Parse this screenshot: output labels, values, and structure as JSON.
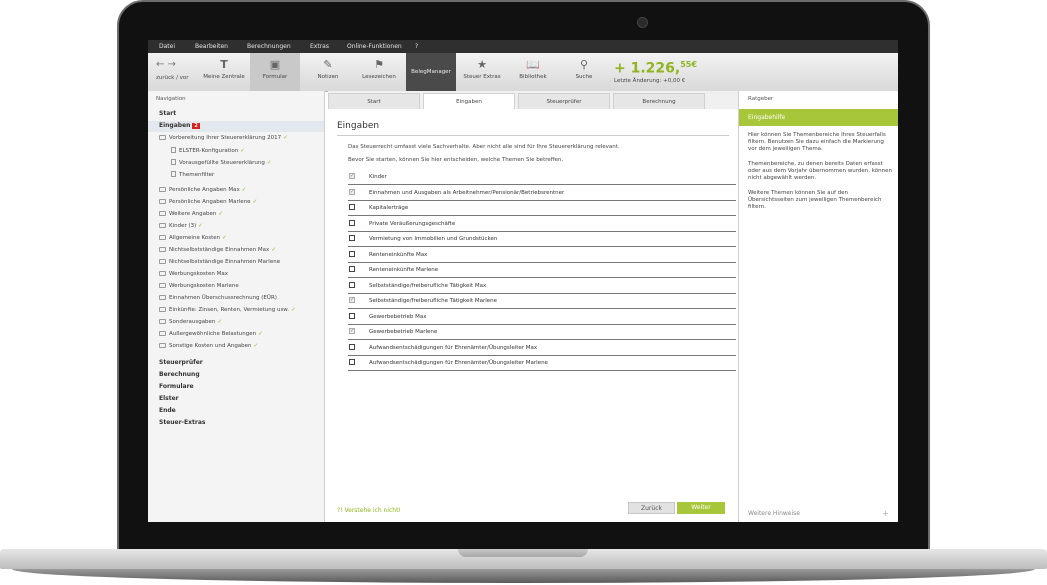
{
  "menu": [
    "Datei",
    "Bearbeiten",
    "Berechnungen",
    "Extras",
    "Online-Funktionen",
    "?"
  ],
  "toolbar": {
    "nav_label": "zurück / vor",
    "buttons": [
      "Meine Zentrale",
      "Formular",
      "Notizen",
      "Lesezeichen",
      "BelegManager",
      "Steuer Extras",
      "Bibliothek",
      "Suche"
    ],
    "balance": "+ 1.226,",
    "balance_cents": "55€",
    "balance_sub": "Letzte Änderung: +0,00 €"
  },
  "sidebar": {
    "heading": "Navigation",
    "start": "Start",
    "eingaben": "Eingaben",
    "eingaben_badge": "2",
    "vorbereitung": "Vorbereitung Ihrer Steuererklärung 2017",
    "sub": [
      "ELSTER-Konfiguration",
      "Vorausgefüllte Steuererklärung",
      "Themenfilter"
    ],
    "topics": [
      "Persönliche Angaben Max",
      "Persönliche Angaben Marlene",
      "Weitere Angaben",
      "Kinder (3)",
      "Allgemeine Kosten",
      "Nichtselbstständige Einnahmen Max",
      "Nichtselbstständige Einnahmen Marlene",
      "Werbungskosten Max",
      "Werbungskosten Marlene",
      "Einnahmen Überschussrechnung (EÜR)",
      "Einkünfte: Zinsen, Renten, Vermietung usw.",
      "Sonderausgaben",
      "Außergewöhnliche Belastungen",
      "Sonstige Kosten und Angaben"
    ],
    "sections": [
      "Steuerprüfer",
      "Berechnung",
      "Formulare",
      "Elster",
      "Ende",
      "Steuer-Extras"
    ]
  },
  "tabs": [
    "Start",
    "Eingaben",
    "Steuerprüfer",
    "Berechnung"
  ],
  "main": {
    "title": "Eingaben",
    "intro1": "Das Steuerrecht umfasst viele Sachverhalte. Aber nicht alle sind für Ihre Steuererklärung relevant.",
    "intro2": "Bevor Sie starten, können Sie hier entscheiden, welche Themen Sie betreffen.",
    "rows": [
      "Kinder",
      "Einnahmen und Ausgaben als Arbeitnehmer/Pensionär/Betriebsrentner",
      "Kapitalerträge",
      "Private Veräußerungsgeschäfte",
      "Vermietung von Immobilien und Grundstücken",
      "Renteneinkünfte Max",
      "Renteneinkünfte Marlene",
      "Selbstständige/freiberufliche Tätigkeit Max",
      "Selbstständige/freiberufliche Tätigkeit Marlene",
      "Gewerbebetrieb Max",
      "Gewerbebetrieb Marlene",
      "Aufwandsentschädigungen für Ehrenämter/Übungsleiter Max",
      "Aufwandsentschädigungen für Ehrenämter/Übungsleiter Marlene"
    ],
    "checked": [
      true,
      true,
      false,
      false,
      false,
      false,
      false,
      false,
      true,
      false,
      true,
      false,
      false
    ],
    "footer_link": "?! Verstehe ich nicht!",
    "back": "Zurück",
    "next": "Weiter"
  },
  "ratgeber": {
    "heading": "Ratgeber",
    "bar": "Eingabehilfe",
    "p1": "Hier können Sie Themenbereiche Ihres Steuerfalls filtern. Benutzen Sie dazu einfach die Markierung vor dem jeweiligen Thema.",
    "p2": "Themenbereiche, zu denen bereits Daten erfasst oder aus dem Vorjahr übernommen wurden, können nicht abgewählt werden.",
    "p3": "Weitere Themen können Sie auf den Übersichtsseiten zum jeweiligen Themenbereich filtern.",
    "bottom": "Weitere Hinweise"
  }
}
